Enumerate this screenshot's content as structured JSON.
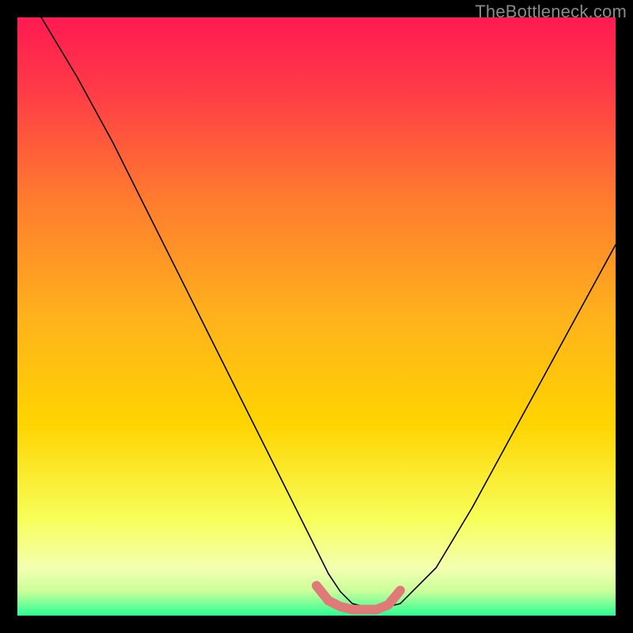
{
  "watermark": "TheBottleneck.com",
  "chart_data": {
    "type": "line",
    "title": "",
    "xlabel": "",
    "ylabel": "",
    "xlim": [
      0,
      100
    ],
    "ylim": [
      0,
      100
    ],
    "grid": false,
    "legend": false,
    "background_gradient": {
      "top_color": "#ff1a52",
      "mid_color": "#ffd400",
      "lower_band": "#f7ff8c",
      "bottom_color": "#2bff94"
    },
    "series": [
      {
        "name": "bottleneck-curve",
        "color": "#000000",
        "width": 1.6,
        "x": [
          4,
          10,
          16,
          22,
          28,
          34,
          40,
          46,
          52,
          54,
          56,
          60,
          64,
          70,
          76,
          82,
          88,
          94,
          100
        ],
        "y": [
          100,
          90,
          79,
          67,
          55,
          43,
          31,
          19,
          7,
          4,
          2,
          1,
          2,
          8,
          18,
          29,
          40,
          51,
          62
        ]
      },
      {
        "name": "valley-highlight",
        "color": "#e07a78",
        "width": 12,
        "x": [
          50,
          52,
          54,
          56,
          58,
          60,
          62,
          64
        ],
        "y": [
          5,
          2.5,
          1.5,
          1,
          1,
          1,
          1.8,
          4.2
        ]
      }
    ]
  }
}
